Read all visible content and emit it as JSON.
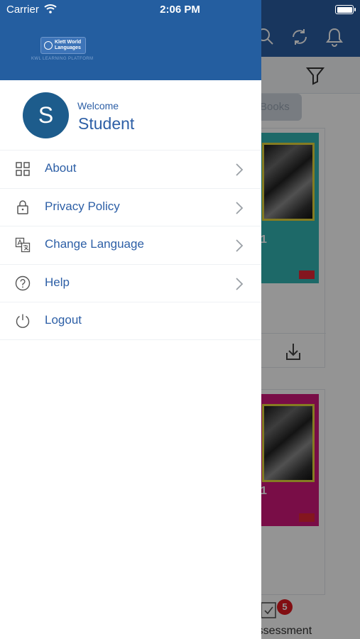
{
  "status_bar": {
    "carrier": "Carrier",
    "time": "2:06 PM"
  },
  "drawer": {
    "brand": {
      "logo_line1": "Klett World",
      "logo_line2": "Languages",
      "tagline": "KWL LEARNING PLATFORM"
    },
    "profile": {
      "initial": "S",
      "welcome": "Welcome",
      "name": "Student"
    },
    "menu": [
      {
        "label": "About",
        "icon": "grid-icon",
        "has_chevron": true
      },
      {
        "label": "Privacy Policy",
        "icon": "lock-icon",
        "has_chevron": true
      },
      {
        "label": "Change Language",
        "icon": "translate-icon",
        "has_chevron": true
      },
      {
        "label": "Help",
        "icon": "question-circle-icon",
        "has_chevron": true
      },
      {
        "label": "Logout",
        "icon": "power-icon",
        "has_chevron": false
      }
    ]
  },
  "background": {
    "filter_chip": "Books",
    "notification_badge": "5",
    "assessment_label": "Assessment",
    "cover_numbers": [
      "1",
      "1"
    ],
    "colors": {
      "header": "#2a5da3",
      "cover1": "#33b6b4",
      "cover2": "#d0177a",
      "badge": "#e0191f"
    }
  },
  "colors": {
    "drawer_header": "#245ea0",
    "accent_text": "#2d5fa6",
    "avatar": "#1d5c8c"
  }
}
